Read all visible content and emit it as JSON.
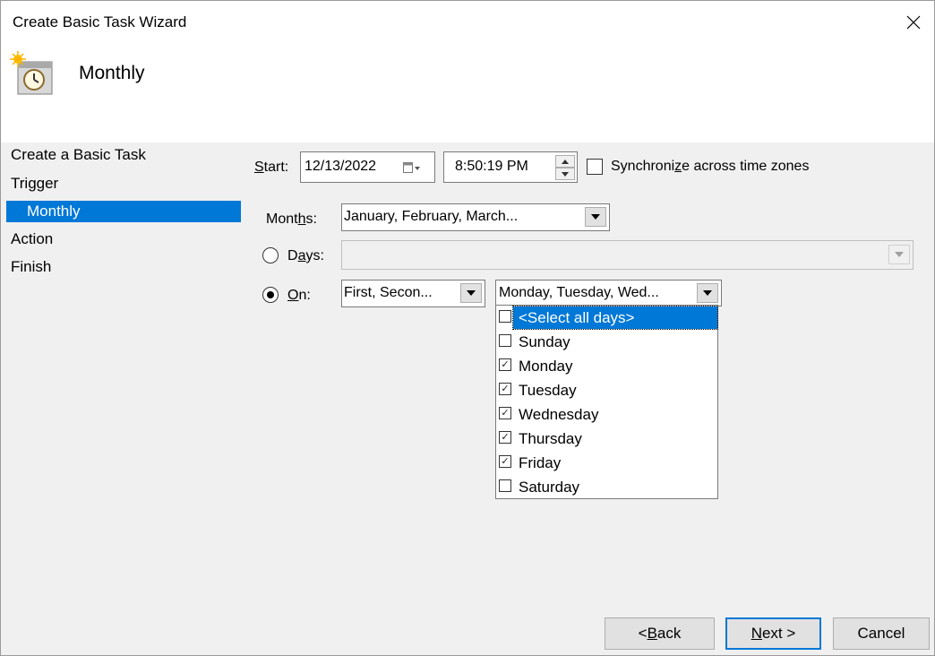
{
  "window": {
    "title": "Create Basic Task Wizard"
  },
  "header": {
    "title": "Monthly",
    "icon": "clock-calendar-icon"
  },
  "sidebar": {
    "items": [
      {
        "label": "Create a Basic Task"
      },
      {
        "label": "Trigger"
      },
      {
        "label": "Monthly",
        "selected": true
      },
      {
        "label": "Action"
      },
      {
        "label": "Finish"
      }
    ]
  },
  "start": {
    "label_first": "S",
    "label_rest": "tart:",
    "date": "12/13/2022",
    "time": "8:50:19 PM",
    "sync_pre": "Synchroni",
    "sync_key": "z",
    "sync_post": "e across time zones",
    "sync_checked": false
  },
  "months": {
    "label_pre": "Mont",
    "label_key": "h",
    "label_post": "s:",
    "value": "January, February, March..."
  },
  "days": {
    "label_pre": "D",
    "label_key": "a",
    "label_post": "ys:",
    "value": "",
    "selected": false
  },
  "on": {
    "label_key": "O",
    "label_post": "n:",
    "selected": true,
    "week_value": "First, Secon...",
    "day_value": "Monday, Tuesday, Wed..."
  },
  "dropdown": {
    "items": [
      {
        "label": "<Select all days>",
        "checked": false,
        "highlighted": true
      },
      {
        "label": "Sunday",
        "checked": false
      },
      {
        "label": "Monday",
        "checked": true
      },
      {
        "label": "Tuesday",
        "checked": true
      },
      {
        "label": "Wednesday",
        "checked": true
      },
      {
        "label": "Thursday",
        "checked": true
      },
      {
        "label": "Friday",
        "checked": true
      },
      {
        "label": "Saturday",
        "checked": false
      }
    ]
  },
  "buttons": {
    "back_pre": "< ",
    "back_key": "B",
    "back_post": "ack",
    "next_key": "N",
    "next_post": "ext >",
    "cancel": "Cancel"
  },
  "colors": {
    "accent": "#0078d7",
    "background": "#f0f0f0"
  }
}
